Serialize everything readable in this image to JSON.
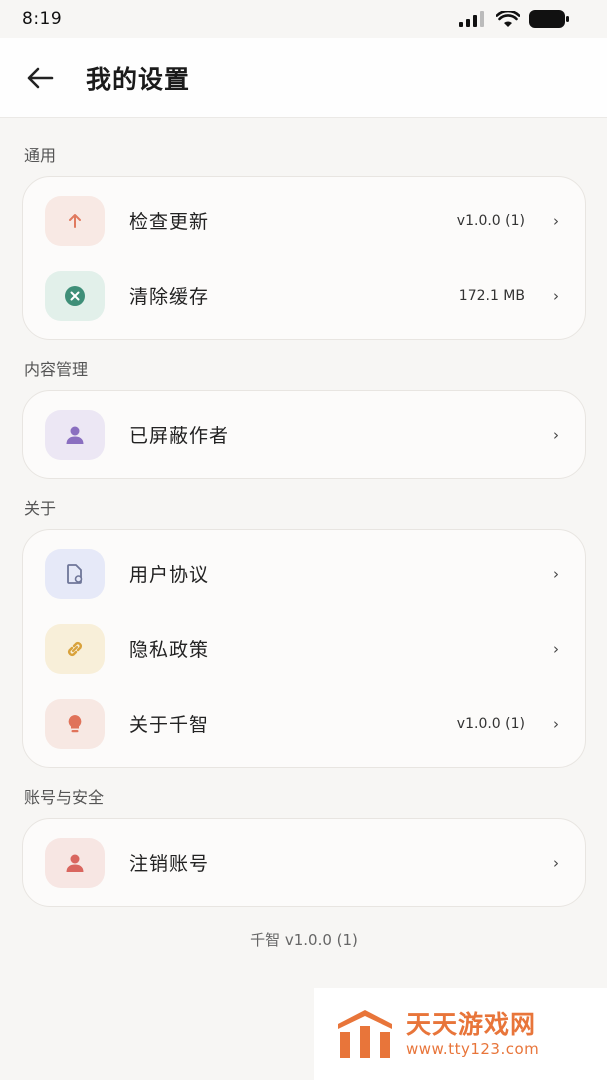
{
  "status_bar": {
    "time": "8:19"
  },
  "header": {
    "title": "我的设置"
  },
  "sections": [
    {
      "label": "通用",
      "items": [
        {
          "label": "检查更新",
          "value": "v1.0.0 (1)",
          "icon": "arrow-up-icon",
          "color": "#e07a5f",
          "bg": "#f8e9e4"
        },
        {
          "label": "清除缓存",
          "value": "172.1 MB",
          "icon": "clear-cache-icon",
          "color": "#3f8f78",
          "bg": "#e2f0ea"
        }
      ]
    },
    {
      "label": "内容管理",
      "items": [
        {
          "label": "已屏蔽作者",
          "value": "",
          "icon": "person-icon",
          "color": "#8a6fc0",
          "bg": "#ece7f4"
        }
      ]
    },
    {
      "label": "关于",
      "items": [
        {
          "label": "用户协议",
          "value": "",
          "icon": "document-icon",
          "color": "#7b82a8",
          "bg": "#e6e9f8"
        },
        {
          "label": "隐私政策",
          "value": "",
          "icon": "link-icon",
          "color": "#d9a23c",
          "bg": "#f8efd9"
        },
        {
          "label": "关于千智",
          "value": "v1.0.0 (1)",
          "icon": "lightbulb-icon",
          "color": "#e0735a",
          "bg": "#f7e8e3"
        }
      ]
    },
    {
      "label": "账号与安全",
      "items": [
        {
          "label": "注销账号",
          "value": "",
          "icon": "person-icon",
          "color": "#d9665f",
          "bg": "#f7e6e3"
        }
      ]
    }
  ],
  "footer": {
    "version": "千智 v1.0.0 (1)"
  },
  "watermark": {
    "title": "天天游戏网",
    "url": "www.tty123.com"
  },
  "chevron": "›"
}
